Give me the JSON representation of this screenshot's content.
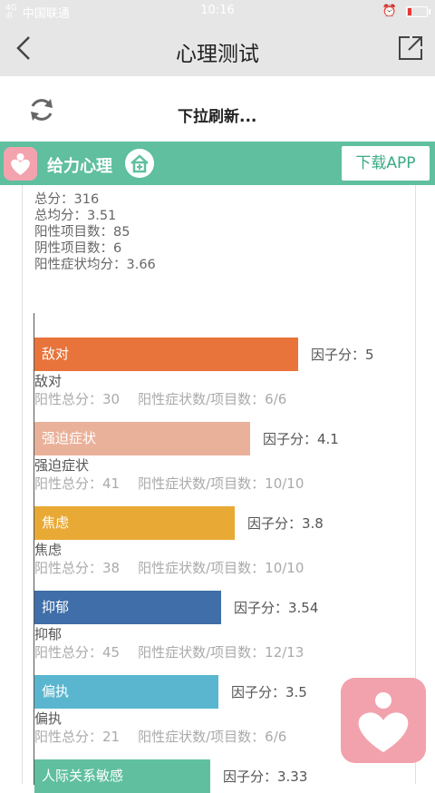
{
  "status_bar": {
    "signal_text": "4G/HD\n4G",
    "carrier": "中国联通",
    "time": "10:16"
  },
  "nav": {
    "title": "心理测试"
  },
  "refresh": {
    "text": "下拉刷新..."
  },
  "brand": {
    "name": "给力心理",
    "download_label": "下载APP",
    "color": "#5fbf9f"
  },
  "summary": {
    "total_score": "总分：316",
    "total_mean": "总均分：3.51",
    "positive_items": "阳性项目数：85",
    "negative_items": "阴性项目数：6",
    "positive_mean": "阳性症状均分：3.66"
  },
  "chart_data": {
    "type": "bar",
    "orientation": "horizontal",
    "categories": [
      "敌对",
      "强迫症状",
      "焦虑",
      "抑郁",
      "偏执",
      "人际关系敏感"
    ],
    "values": [
      5,
      4.1,
      3.8,
      3.54,
      3.5,
      3.33
    ],
    "xlim": [
      0,
      5.85
    ],
    "colors": [
      "#e8743b",
      "#eab19a",
      "#e8a935",
      "#3f6ea8",
      "#5ab6cf",
      "#5fbf9f"
    ],
    "factor_labels": [
      "因子分：5",
      "因子分：4.1",
      "因子分：3.8",
      "因子分：3.54",
      "因子分：3.5",
      "因子分：3.33"
    ],
    "details": [
      {
        "name": "敌对",
        "positive_total": "阳性总分：30",
        "ratio": "阳性症状数/项目数：6/6"
      },
      {
        "name": "强迫症状",
        "positive_total": "阳性总分：41",
        "ratio": "阳性症状数/项目数：10/10"
      },
      {
        "name": "焦虑",
        "positive_total": "阳性总分：38",
        "ratio": "阳性症状数/项目数：10/10"
      },
      {
        "name": "抑郁",
        "positive_total": "阳性总分：45",
        "ratio": "阳性症状数/项目数：12/13"
      },
      {
        "name": "偏执",
        "positive_total": "阳性总分：21",
        "ratio": "阳性症状数/项目数：6/6"
      }
    ]
  }
}
